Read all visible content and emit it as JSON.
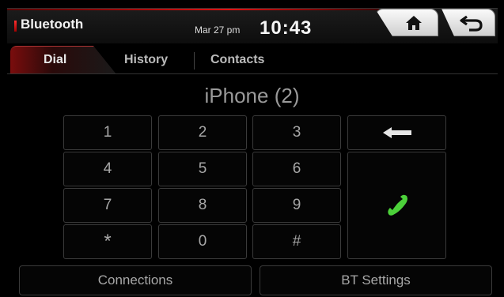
{
  "header": {
    "app_title": "Bluetooth",
    "date": "Mar 27 pm",
    "time": "10:43",
    "accent_color": "#e01010"
  },
  "nav": {
    "home_icon": "home-icon",
    "back_icon": "back-arrow-icon"
  },
  "tabs": [
    {
      "label": "Dial",
      "active": true
    },
    {
      "label": "History",
      "active": false
    },
    {
      "label": "Contacts",
      "active": false
    }
  ],
  "device_name": "iPhone (2)",
  "keypad": {
    "keys": [
      "1",
      "2",
      "3",
      "4",
      "5",
      "6",
      "7",
      "8",
      "9",
      "*",
      "0",
      "#"
    ],
    "backspace_icon": "backspace-arrow-icon",
    "call_icon": "phone-handset-icon",
    "call_color": "#4cd13a"
  },
  "footer": {
    "connections_label": "Connections",
    "bt_settings_label": "BT Settings"
  }
}
